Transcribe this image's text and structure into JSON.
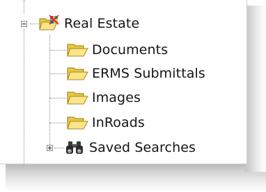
{
  "tree": {
    "root": {
      "label": "Real Estate",
      "icon": "project-folder-icon",
      "expanded": true,
      "children": [
        {
          "label": "Documents",
          "icon": "folder-icon"
        },
        {
          "label": "ERMS Submittals",
          "icon": "folder-icon"
        },
        {
          "label": "Images",
          "icon": "folder-icon"
        },
        {
          "label": "InRoads",
          "icon": "folder-icon"
        },
        {
          "label": "Saved Searches",
          "icon": "binoculars-icon",
          "expanded": false
        }
      ]
    }
  }
}
